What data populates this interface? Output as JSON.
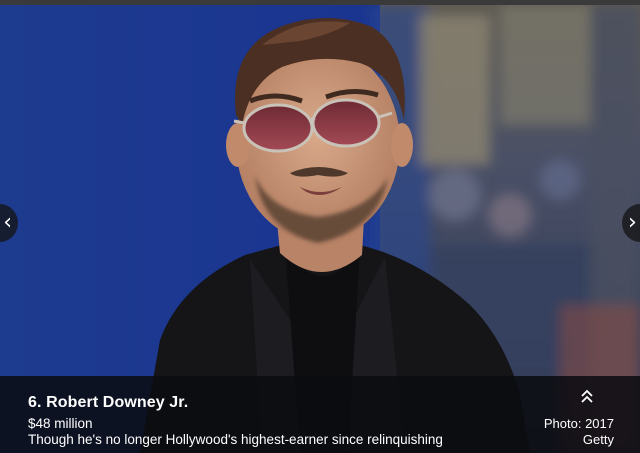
{
  "slideshow": {
    "caption": {
      "title": "6. Robert Downey Jr.",
      "earnings": "$48 million",
      "description": "Though he's no longer Hollywood's highest-earner since relinquishing"
    },
    "credit": {
      "line1": "Photo: 2017",
      "line2": "Getty"
    },
    "icons": {
      "prev": "chevron-left-icon",
      "next": "chevron-right-icon",
      "expand": "double-chevron-up-icon"
    },
    "prev_glyph": "‹",
    "next_glyph": "›",
    "colors": {
      "backdrop_blue": "#1c3a8c",
      "caption_bg": "#0a0c10",
      "text": "#ffffff"
    }
  }
}
